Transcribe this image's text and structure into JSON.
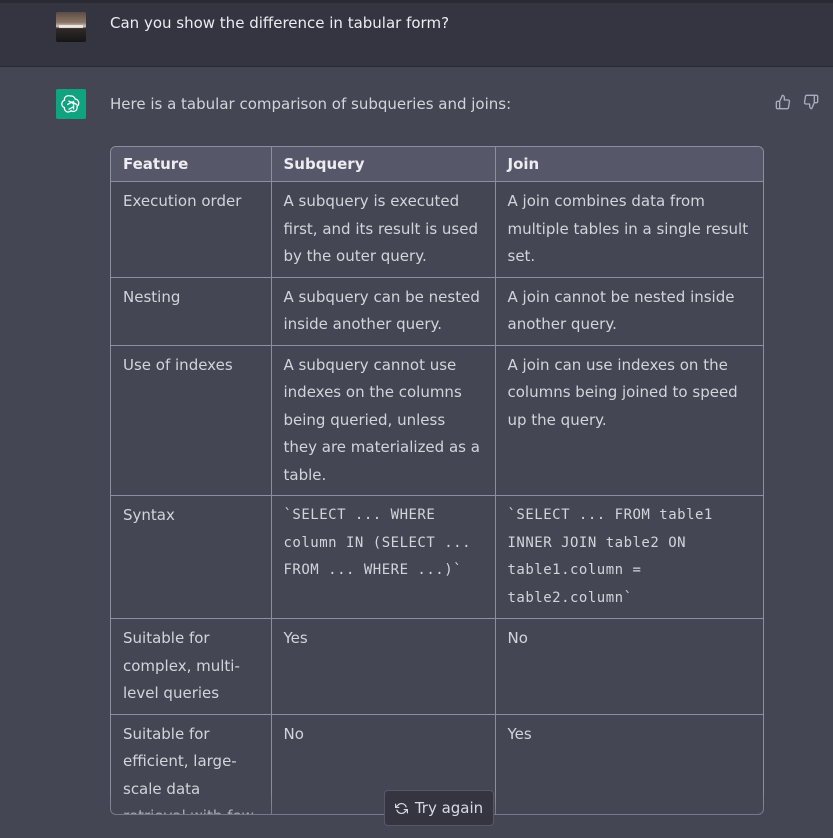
{
  "user_message": "Can you show the difference in tabular form?",
  "assistant": {
    "intro": "Here is a tabular comparison of subqueries and joins:",
    "icon": "openai-logo-icon",
    "accent_color": "#10a37f"
  },
  "table": {
    "headers": [
      "Feature",
      "Subquery",
      "Join"
    ],
    "rows": [
      [
        "Execution order",
        "A subquery is executed first, and its result is used by the outer query.",
        "A join combines data from multiple tables in a single result set."
      ],
      [
        "Nesting",
        "A subquery can be nested inside another query.",
        "A join cannot be nested inside another query."
      ],
      [
        "Use of indexes",
        "A subquery cannot use indexes on the columns being queried, unless they are materialized as a table.",
        "A join can use indexes on the columns being joined to speed up the query."
      ],
      [
        "Syntax",
        "`SELECT ... WHERE column IN (SELECT ... FROM ... WHERE ...)`",
        "`SELECT ... FROM table1 INNER JOIN table2 ON table1.column = table2.column`"
      ],
      [
        "Suitable for complex, multi-level queries",
        "Yes",
        "No"
      ],
      [
        "Suitable for efficient, large-scale data retrieval with few joins.",
        "No",
        "Yes"
      ]
    ]
  },
  "actions": {
    "try_again": "Try again",
    "thumbs_up_icon": "thumbs-up-icon",
    "thumbs_down_icon": "thumbs-down-icon"
  }
}
